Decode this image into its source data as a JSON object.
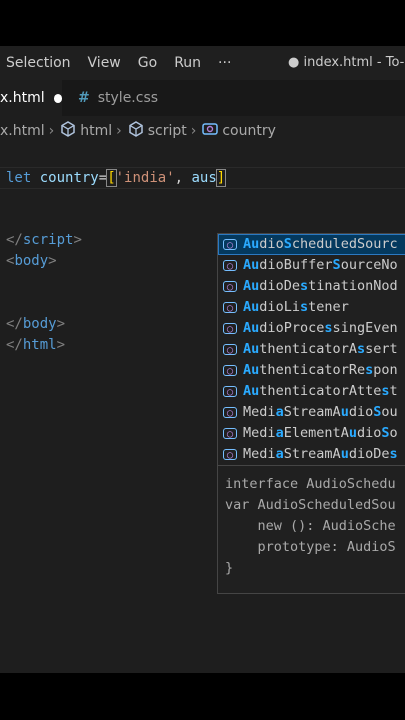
{
  "menubar": {
    "items": [
      "Selection",
      "View",
      "Go",
      "Run"
    ],
    "more": "···",
    "window_title": "● index.html - To-do"
  },
  "tabs": {
    "active_label": "x.html",
    "inactive_icon": "#",
    "inactive_label": "style.css"
  },
  "breadcrumb": {
    "file": "x.html",
    "items": [
      "html",
      "script",
      "country"
    ]
  },
  "editor": {
    "line1": {
      "kw": "let",
      "var": "country",
      "eq": "=",
      "open": "[",
      "str": "'india'",
      "sep": ", ",
      "typed": "aus",
      "close": "]"
    },
    "lines": [
      {
        "lt": "</",
        "tag": "script",
        "gt": ">"
      },
      {
        "lt": "<",
        "tag": "body",
        "gt": ">"
      },
      {
        "lt": "</",
        "tag": "body",
        "gt": ">"
      },
      {
        "lt": "</",
        "tag": "html",
        "gt": ">"
      }
    ]
  },
  "suggestions": [
    "AudioScheduledSourc",
    "AudioBufferSourceNo",
    "AudioDestinationNod",
    "AudioListener",
    "AudioProcessingEven",
    "AuthenticatorAssert",
    "AuthenticatorRespon",
    "AuthenticatorAttest",
    "MediaStreamAudioSou",
    "MediaElementAudioSo",
    "MediaStreamAudioDes"
  ],
  "detail": [
    "interface AudioSchedu",
    "var AudioScheduledSou",
    "    new (): AudioSche",
    "    prototype: AudioS",
    "}"
  ],
  "colors": {
    "statusbar": "#007acc",
    "highlight": "#2aaaff"
  }
}
